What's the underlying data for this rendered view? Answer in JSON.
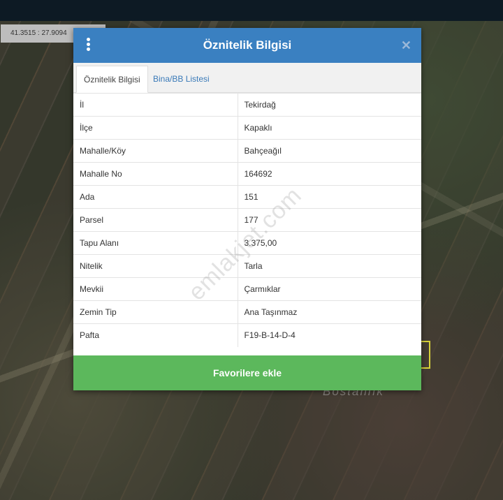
{
  "map": {
    "coordinates": "41.3515 : 27.9094",
    "place_label": "Bostanlık"
  },
  "dialog": {
    "title": "Öznitelik Bilgisi",
    "close_glyph": "✕",
    "tabs": [
      {
        "label": "Öznitelik Bilgisi",
        "active": true
      },
      {
        "label": "Bina/BB Listesi",
        "active": false
      }
    ],
    "rows": [
      {
        "key": "İl",
        "value": "Tekirdağ"
      },
      {
        "key": "İlçe",
        "value": "Kapaklı"
      },
      {
        "key": "Mahalle/Köy",
        "value": "Bahçeağıl"
      },
      {
        "key": "Mahalle No",
        "value": "164692"
      },
      {
        "key": "Ada",
        "value": "151"
      },
      {
        "key": "Parsel",
        "value": "177"
      },
      {
        "key": "Tapu Alanı",
        "value": "3.375,00"
      },
      {
        "key": "Nitelik",
        "value": "Tarla"
      },
      {
        "key": "Mevkii",
        "value": "Çarmıklar"
      },
      {
        "key": "Zemin Tip",
        "value": "Ana Taşınmaz"
      },
      {
        "key": "Pafta",
        "value": "F19-B-14-D-4"
      }
    ],
    "favorite_button": "Favorilere ekle"
  },
  "watermark": "emlakjet.com",
  "colors": {
    "header": "#3a80c1",
    "favorite_button": "#5cb85c",
    "tab_link": "#3a7ab8"
  }
}
